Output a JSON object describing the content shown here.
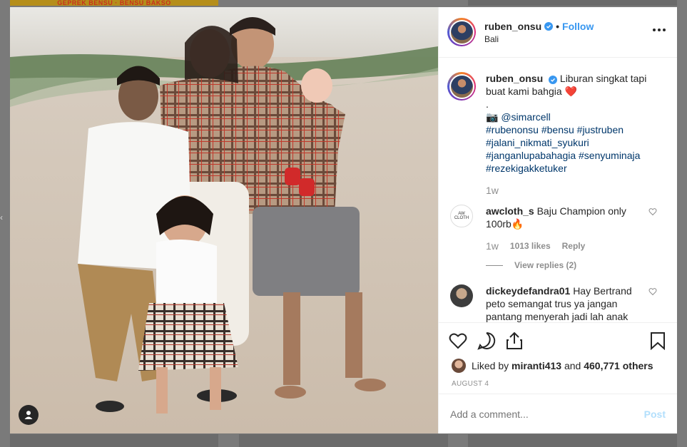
{
  "background": {
    "banner_text": "GEPREK BENSU · BENSU BAKSO"
  },
  "post": {
    "username": "ruben_onsu",
    "follow_label": "Follow",
    "location": "Bali",
    "caption": {
      "username": "ruben_onsu",
      "text_line1": "Liburan singkat tapi",
      "text_line2": "buat kami bahgia",
      "heart": "❤️",
      "dot": ".",
      "camera": "📷",
      "mention": "@simarcell",
      "hashtags": [
        "#rubenonsu #bensu #justruben",
        "#jalani_nikmati_syukuri",
        "#janganlupabahagia #senyuminaja",
        "#rezekigakketuker"
      ],
      "time": "1w"
    },
    "comments": [
      {
        "username": "awcloth_s",
        "text_line1": "Baju Champion only",
        "text_line2": "100rb🔥",
        "avatar_label": "AW CLOTH",
        "time": "1w",
        "likes": "1013 likes",
        "reply": "Reply",
        "view_replies": "View replies (2)"
      },
      {
        "username": "dickeydefandra01",
        "text_line1": "Hay Bertrand",
        "text_line2": "peto semangat trus ya jangan",
        "text_line3": "pantang menyerah jadi lah anak"
      }
    ],
    "liked_by_prefix": "Liked by",
    "liked_by_user": "miranti413",
    "liked_by_and": "and",
    "liked_by_others": "460,771 others",
    "date": "AUGUST 4",
    "add_comment_placeholder": "Add a comment...",
    "post_label": "Post"
  },
  "colors": {
    "link": "#3897f0",
    "hashtag": "#00376b",
    "heart": "#ed4956"
  },
  "icons": [
    "user-tag-icon",
    "verified-icon",
    "more-icon",
    "heart-icon",
    "comment-icon",
    "share-icon",
    "bookmark-icon"
  ]
}
